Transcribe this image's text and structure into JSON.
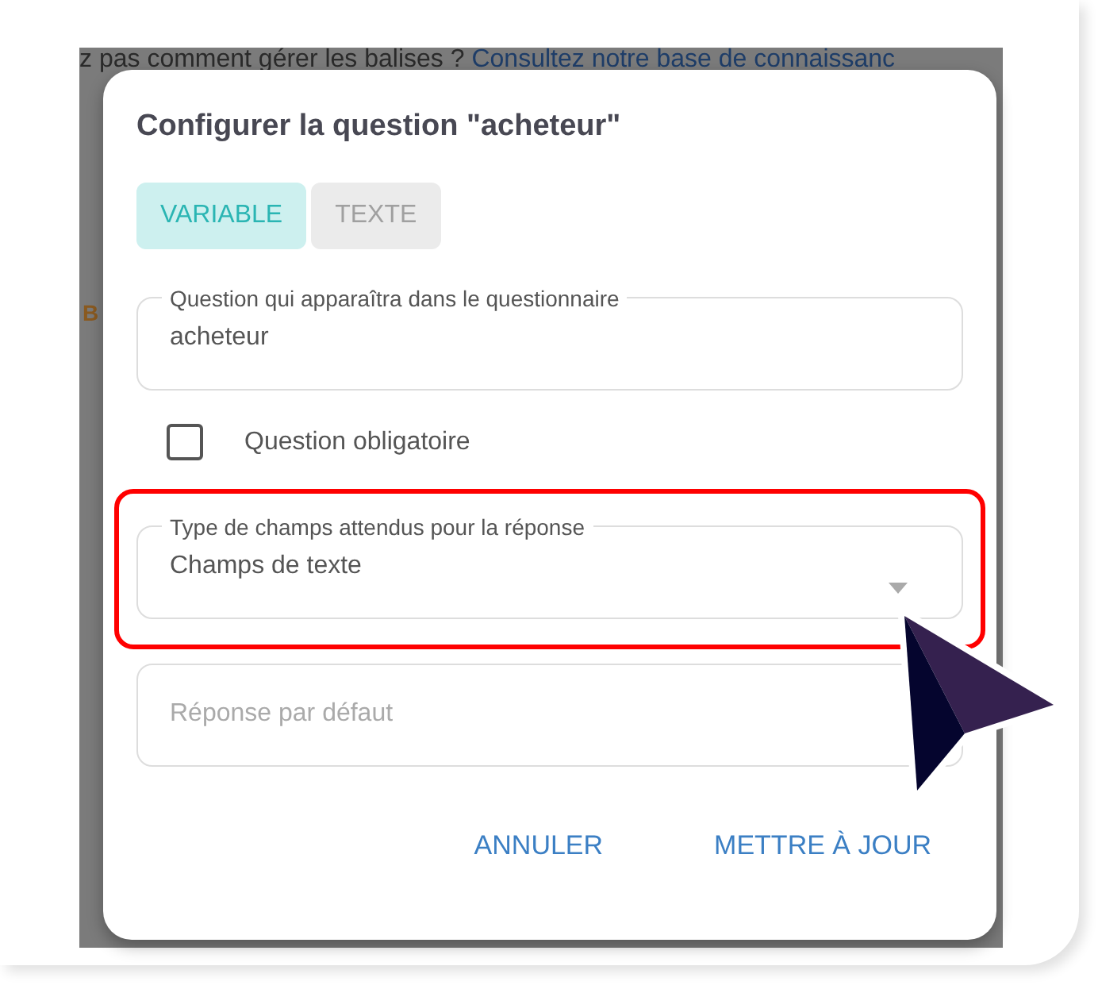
{
  "background": {
    "hint_text": "z pas comment gérer les balises ? ",
    "hint_link": "Consultez notre base de connaissanc",
    "side_text": "B"
  },
  "dialog": {
    "title": "Configurer la question \"acheteur\"",
    "tabs": [
      {
        "label": "VARIABLE",
        "selected": true
      },
      {
        "label": "TEXTE",
        "selected": false
      }
    ],
    "question_field": {
      "label": "Question qui apparaîtra dans le questionnaire",
      "value": "acheteur"
    },
    "required_checkbox": {
      "label": "Question obligatoire",
      "checked": false
    },
    "answer_type_select": {
      "label": "Type de champs attendus pour la réponse",
      "value": "Champs de texte",
      "highlighted": true
    },
    "default_answer_field": {
      "placeholder": "Réponse par défaut"
    },
    "buttons": [
      "ANNULER",
      "METTRE À JOUR"
    ]
  }
}
